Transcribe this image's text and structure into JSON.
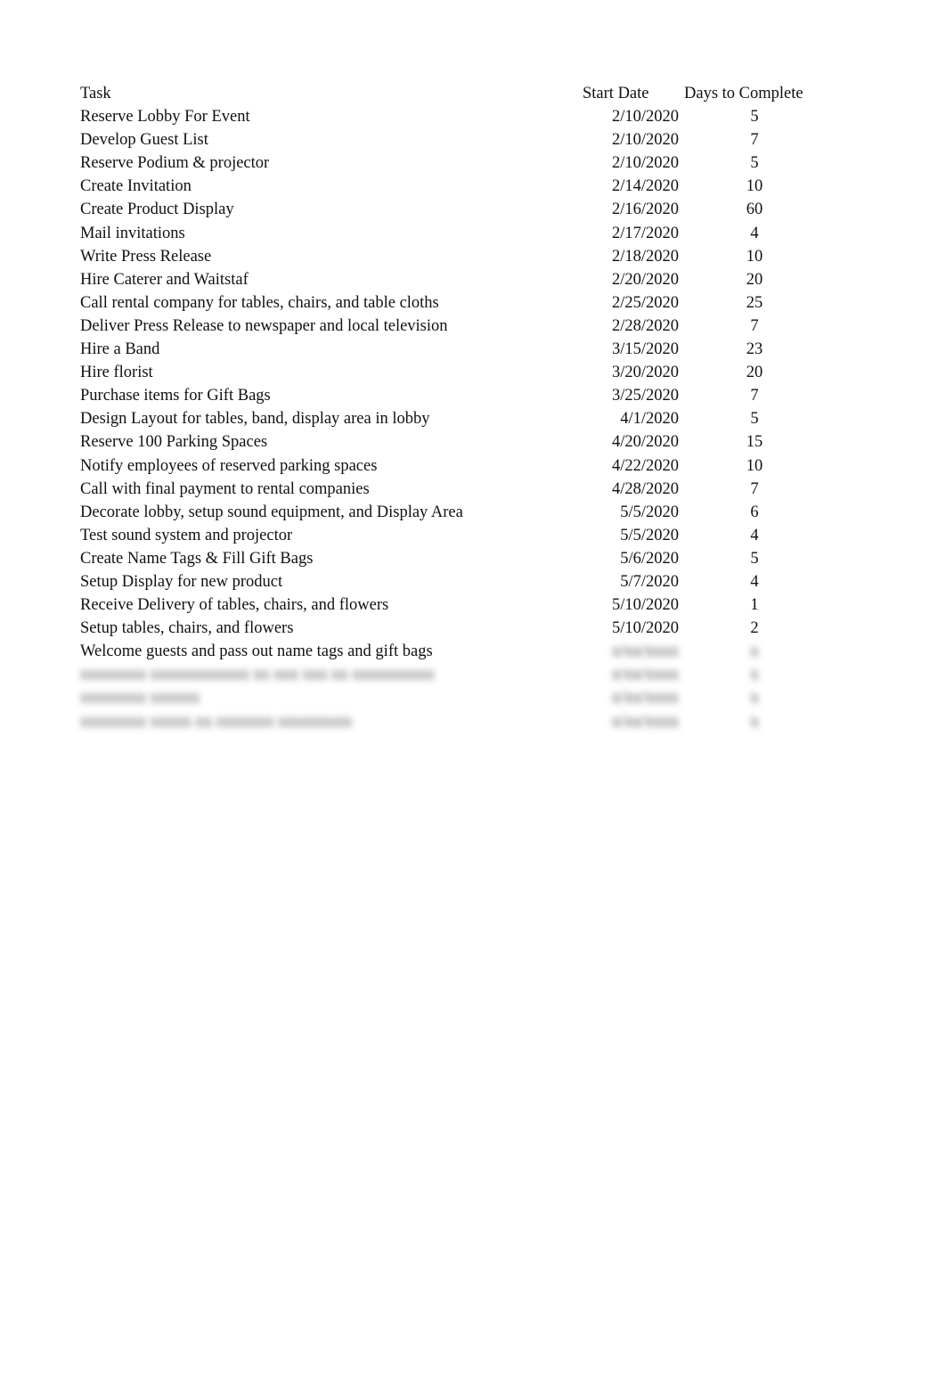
{
  "table": {
    "headers": {
      "task": "Task",
      "start_date": "Start Date",
      "days": "Days to Complete"
    },
    "rows": [
      {
        "task": "Reserve Lobby For Event",
        "start_date": "2/10/2020",
        "days": "5"
      },
      {
        "task": "Develop Guest List",
        "start_date": "2/10/2020",
        "days": "7"
      },
      {
        "task": "Reserve Podium & projector",
        "start_date": "2/10/2020",
        "days": "5"
      },
      {
        "task": "Create Invitation",
        "start_date": "2/14/2020",
        "days": "10"
      },
      {
        "task": "Create Product Display",
        "start_date": "2/16/2020",
        "days": "60"
      },
      {
        "task": "Mail invitations",
        "start_date": "2/17/2020",
        "days": "4"
      },
      {
        "task": "Write Press Release",
        "start_date": "2/18/2020",
        "days": "10"
      },
      {
        "task": "Hire Caterer and Waitstaf",
        "start_date": "2/20/2020",
        "days": "20"
      },
      {
        "task": "Call rental company for tables, chairs, and table cloths",
        "start_date": "2/25/2020",
        "days": "25"
      },
      {
        "task": "Deliver Press Release to newspaper and local television",
        "start_date": "2/28/2020",
        "days": "7"
      },
      {
        "task": "Hire a Band",
        "start_date": "3/15/2020",
        "days": "23"
      },
      {
        "task": "Hire florist",
        "start_date": "3/20/2020",
        "days": "20"
      },
      {
        "task": "Purchase items for Gift Bags",
        "start_date": "3/25/2020",
        "days": "7"
      },
      {
        "task": "Design Layout for tables, band, display area in lobby",
        "start_date": "4/1/2020",
        "days": "5"
      },
      {
        "task": "Reserve 100 Parking Spaces",
        "start_date": "4/20/2020",
        "days": "15"
      },
      {
        "task": "Notify employees of reserved parking spaces",
        "start_date": "4/22/2020",
        "days": "10"
      },
      {
        "task": "Call with final payment to rental companies",
        "start_date": "4/28/2020",
        "days": "7"
      },
      {
        "task": "Decorate lobby, setup sound equipment, and Display Area",
        "start_date": "5/5/2020",
        "days": "6"
      },
      {
        "task": "Test sound system and projector",
        "start_date": "5/5/2020",
        "days": "4"
      },
      {
        "task": "Create Name Tags & Fill Gift Bags",
        "start_date": "5/6/2020",
        "days": "5"
      },
      {
        "task": "Setup Display for new product",
        "start_date": "5/7/2020",
        "days": "4"
      },
      {
        "task": "Receive Delivery of tables, chairs, and flowers",
        "start_date": "5/10/2020",
        "days": "1"
      },
      {
        "task": "Setup tables, chairs, and flowers",
        "start_date": "5/10/2020",
        "days": "2"
      },
      {
        "task": "Welcome guests and pass out name tags and gift bags",
        "start_date": "",
        "days": ""
      }
    ],
    "blurred_rows": [
      {
        "task": "xxxxxxxx xxxxxxxxxxxx xx xxx xxx xx xxxxxxxxxx",
        "start_date": "x/xx/xxxx",
        "days": "x"
      },
      {
        "task": "xxxxxxxx xxxxxx",
        "start_date": "x/xx/xxxx",
        "days": "x"
      },
      {
        "task": "xxxxxxxx xxxxx xx xxxxxxx xxxxxxxxx",
        "start_date": "x/xx/xxxx",
        "days": "x"
      }
    ],
    "blurred_last_visible_row": {
      "start_date": "x/xx/xxxx",
      "days": "x"
    }
  }
}
